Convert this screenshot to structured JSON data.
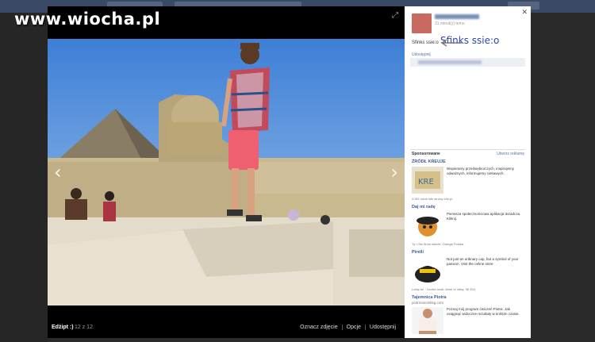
{
  "watermark": "www.wiocha.pl",
  "viewer": {
    "album_title": "Edżipt :)",
    "photo_count": "12 z 12",
    "actions": [
      "Oznacz zdjęcie",
      "Opcje",
      "Udostępnij"
    ]
  },
  "post": {
    "meta": "31 minut(y) temu",
    "text": "Sfinks ssie:o",
    "share_label": "Udostępnij"
  },
  "annotation": "Sfinks ssie:o",
  "sponsored": {
    "heading": "Sponsorowane",
    "create_link": "Utwórz reklamę",
    "ads": [
      {
        "title": "ŹRÓDŁ KREUJE",
        "text": "Wspieramy przedsiębiorczych, inspirujemy odważnych, informujemy ciekawych.",
        "like": "4 961 osób lubi stronę bzk.pl."
      },
      {
        "title": "Daj mi radę",
        "text": "Pierwsza społecznościowa aplikacja doradcza. Kliknij.",
        "like": "Ty i Ola Stula lubicie: Orange Polska."
      },
      {
        "title": "Pirelli",
        "text": "Not just an ordinary cap, but a symbol of your passion. Visit the online store",
        "like": "Lubię to! · Liczba osób, które to lubią: 96 254."
      },
      {
        "title": "Tajemnica Piotra",
        "sub": "piotrmusclebkg.com",
        "text": "Poznaj mój program ćwiczeń Piotra. Jak osiągnąć widoczne rezultaty w krótkim czasie."
      }
    ]
  },
  "colors": {
    "fb_blue": "#3b5998",
    "annotation_blue": "#2b47b8",
    "sky": "#5a8fd8",
    "sand": "#d9cfb4"
  }
}
